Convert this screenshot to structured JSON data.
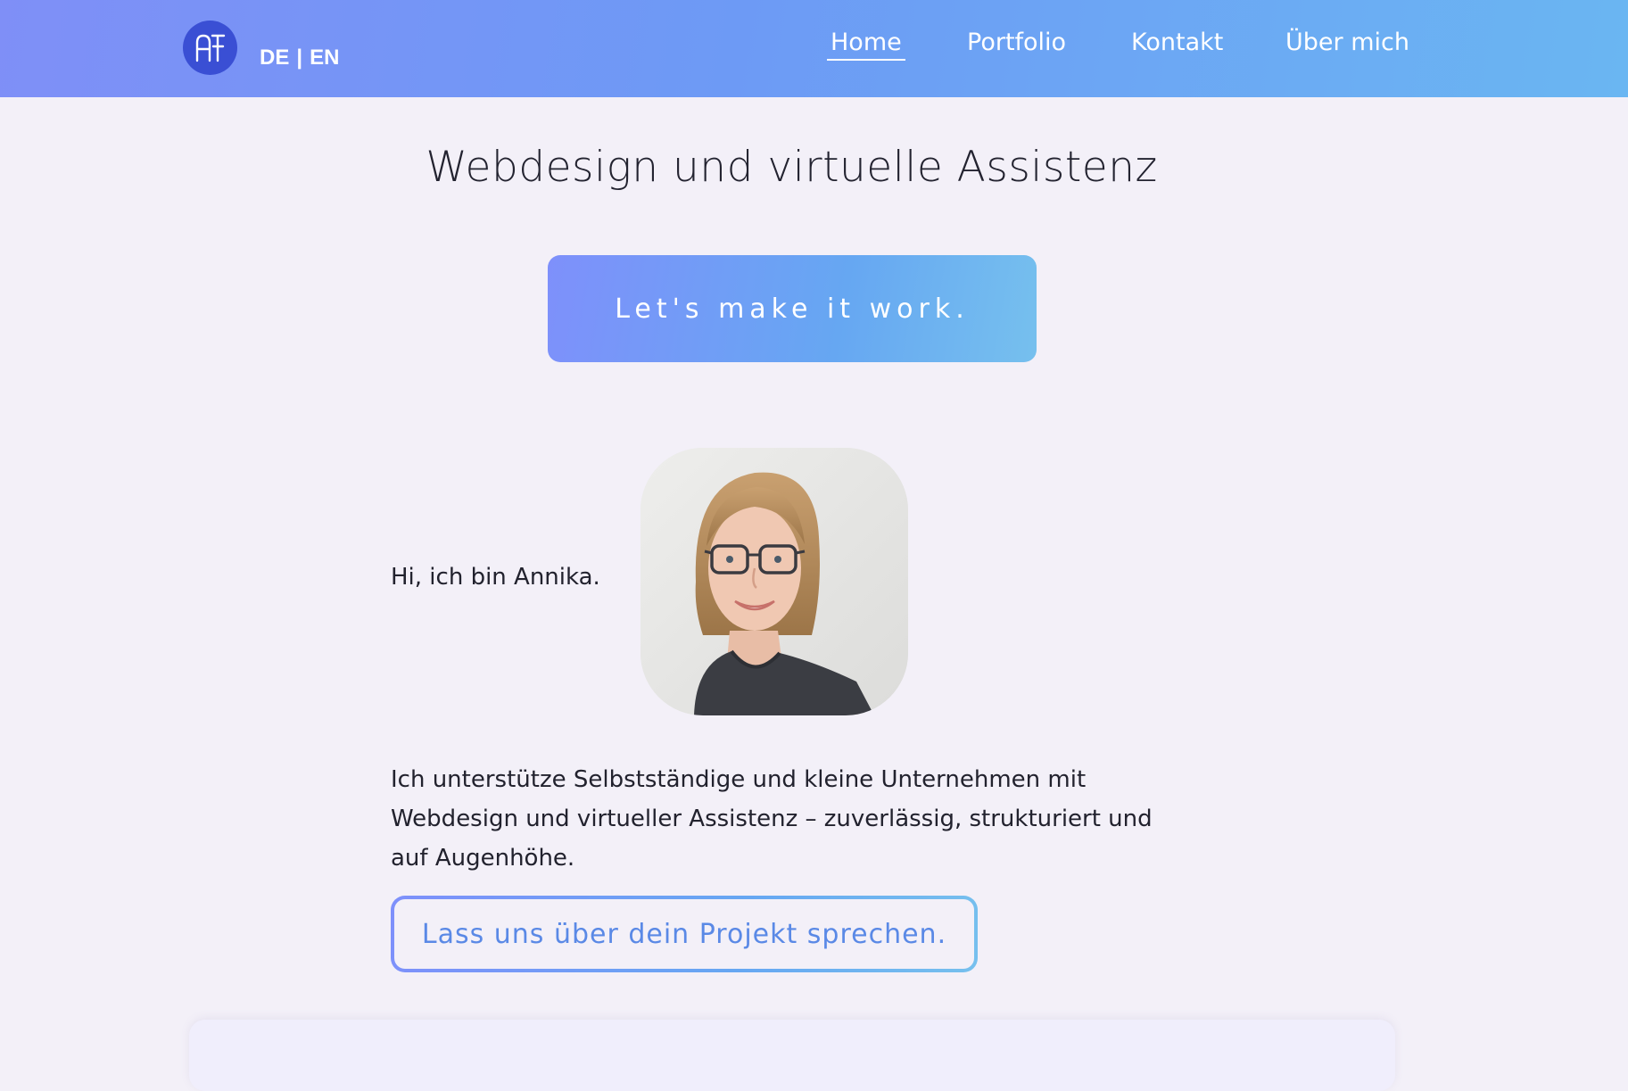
{
  "header": {
    "logo_text": "AT",
    "lang": {
      "de": "DE",
      "separator": "|",
      "en": "EN"
    },
    "nav": [
      {
        "label": "Home",
        "active": true
      },
      {
        "label": "Portfolio",
        "active": false
      },
      {
        "label": "Kontakt",
        "active": false
      },
      {
        "label": "Über mich",
        "active": false
      }
    ]
  },
  "hero": {
    "title": "Webdesign und virtuelle Assistenz",
    "cta_label": "Let's make it work."
  },
  "intro": {
    "greeting": "Hi, ich bin Annika.",
    "description": "Ich unterstütze Selbstständige und kleine Unternehmen mit Webdesign und virtueller Assistenz – zuverlässig, strukturiert und auf Augenhöhe.",
    "project_cta_label": "Lass uns über dein Projekt sprechen."
  },
  "colors": {
    "header_gradient_start": "#7f8ff7",
    "header_gradient_end": "#6ab6f2",
    "logo_background": "#3a4fd4",
    "page_background": "#f3f0f8",
    "secondary_cta_text": "#5a89e6"
  }
}
